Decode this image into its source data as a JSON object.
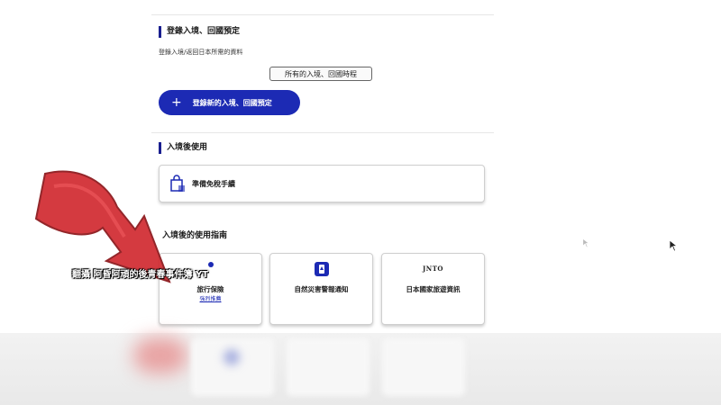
{
  "registration": {
    "title": "登錄入境、回國預定",
    "description": "登錄入境/返回日本所需的資料",
    "all_trips_label": "所有的入境、回國時程",
    "new_trip_label": "登錄新的入境、回國預定"
  },
  "after_entry": {
    "title": "入境後使用",
    "duty_free_label": "準備免稅手續"
  },
  "guide": {
    "title": "入境後的使用指南",
    "cards": [
      {
        "label": "旅行保險",
        "sub": "強烈推薦"
      },
      {
        "label": "自然災害警報通知"
      },
      {
        "label": "日本國家旅遊資訊",
        "logo": "JNTO"
      }
    ]
  },
  "overlay": {
    "caption": "翻攝 阿昏阿頑的後青春事件簿 YT"
  },
  "colors": {
    "accent": "#1c2ab4",
    "section_bar": "#1a1f8f",
    "arrow": "#c8232b"
  }
}
